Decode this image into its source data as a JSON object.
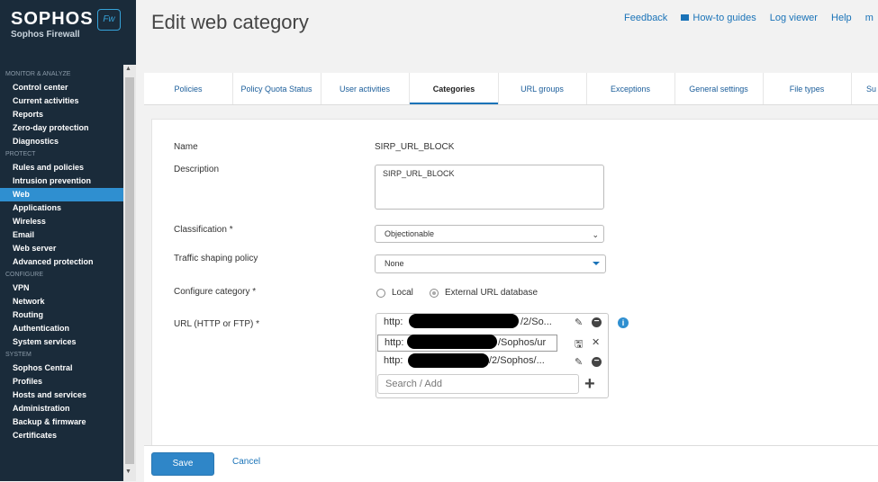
{
  "brand": {
    "name": "SOPHOS",
    "subtitle": "Sophos Firewall",
    "badge": "Fw"
  },
  "header": {
    "title": "Edit web category",
    "links": [
      "Feedback",
      "How-to guides",
      "Log viewer",
      "Help",
      "m"
    ]
  },
  "sidebar": {
    "sections": [
      {
        "title": "MONITOR & ANALYZE",
        "items": [
          "Control center",
          "Current activities",
          "Reports",
          "Zero-day protection",
          "Diagnostics"
        ]
      },
      {
        "title": "PROTECT",
        "items": [
          "Rules and policies",
          "Intrusion prevention",
          "Web",
          "Applications",
          "Wireless",
          "Email",
          "Web server",
          "Advanced protection"
        ]
      },
      {
        "title": "CONFIGURE",
        "items": [
          "VPN",
          "Network",
          "Routing",
          "Authentication",
          "System services"
        ]
      },
      {
        "title": "SYSTEM",
        "items": [
          "Sophos Central",
          "Profiles",
          "Hosts and services",
          "Administration",
          "Backup & firmware",
          "Certificates"
        ]
      }
    ],
    "active_item": "Web"
  },
  "tabs": [
    "Policies",
    "Policy Quota Status",
    "User activities",
    "Categories",
    "URL groups",
    "Exceptions",
    "General settings",
    "File types",
    "Su"
  ],
  "active_tab": "Categories",
  "form": {
    "name_label": "Name",
    "name_value": "SIRP_URL_BLOCK",
    "description_label": "Description",
    "description_value": "SIRP_URL_BLOCK",
    "classification_label": "Classification *",
    "classification_value": "Objectionable",
    "traffic_label": "Traffic shaping policy",
    "traffic_value": "None",
    "configure_label": "Configure category *",
    "radio_local": "Local",
    "radio_external": "External URL database",
    "selected_radio": "External URL database",
    "url_label": "URL (HTTP or FTP) *",
    "urls": [
      {
        "prefix": "http:",
        "suffix": "/2/So..."
      },
      {
        "prefix": "http:",
        "suffix": "/Sophos/ur"
      },
      {
        "prefix": "http:",
        "suffix": "/2/Sophos/..."
      }
    ],
    "search_placeholder": "Search / Add"
  },
  "footer": {
    "save": "Save",
    "cancel": "Cancel"
  }
}
